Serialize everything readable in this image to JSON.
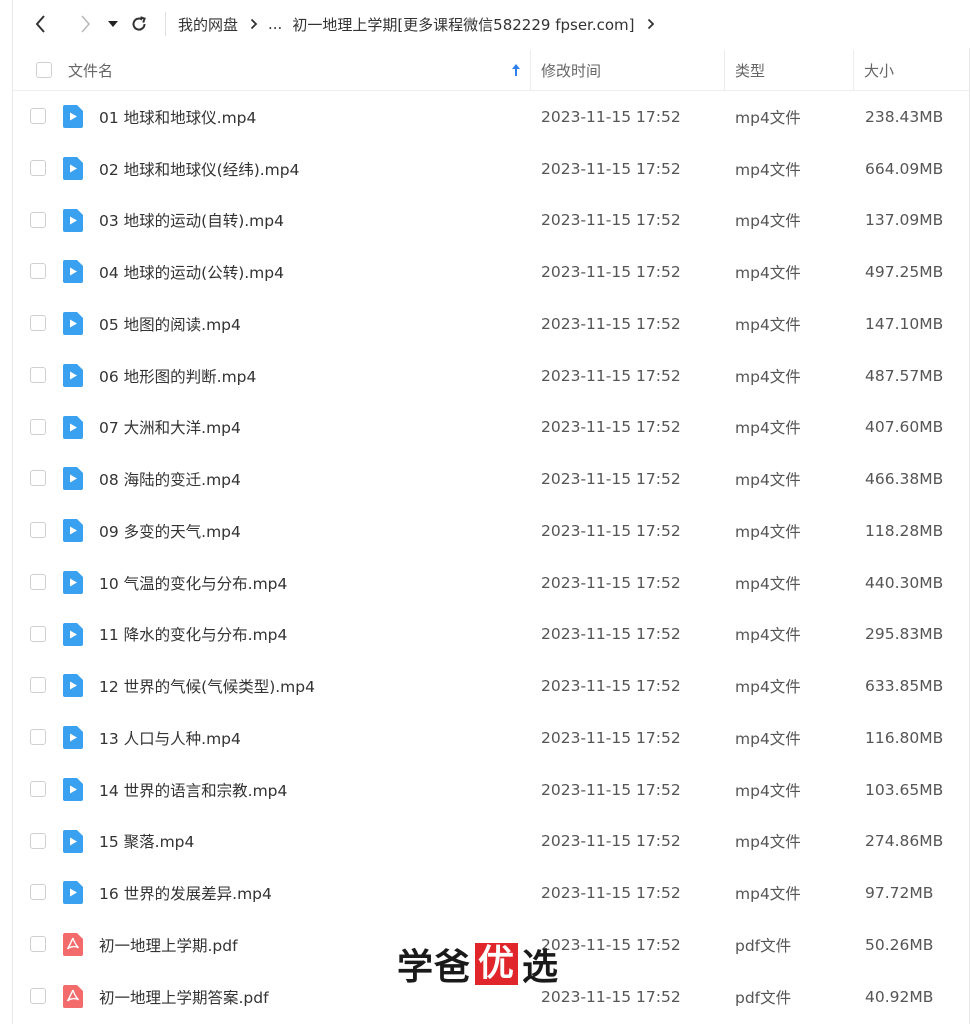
{
  "nav": {
    "back_icon": "chevron-left-icon",
    "forward_icon": "chevron-right-icon",
    "dropdown_icon": "caret-down-icon",
    "refresh_icon": "refresh-icon"
  },
  "breadcrumb": {
    "root": "我的网盘",
    "ellipsis": "...",
    "current": "初一地理上学期[更多课程微信582229 fpser.com]"
  },
  "table": {
    "headers": {
      "name": "文件名",
      "mtime": "修改时间",
      "type": "类型",
      "size": "大小"
    },
    "sort": {
      "column": "name",
      "direction": "ascending",
      "icon": "arrow-up-icon",
      "color": "#2f80ed"
    },
    "rows": [
      {
        "name": "01 地球和地球仪.mp4",
        "mtime": "2023-11-15 17:52",
        "type": "mp4文件",
        "size": "238.43MB",
        "icon": "video-file-icon"
      },
      {
        "name": "02 地球和地球仪(经纬).mp4",
        "mtime": "2023-11-15 17:52",
        "type": "mp4文件",
        "size": "664.09MB",
        "icon": "video-file-icon"
      },
      {
        "name": "03 地球的运动(自转).mp4",
        "mtime": "2023-11-15 17:52",
        "type": "mp4文件",
        "size": "137.09MB",
        "icon": "video-file-icon"
      },
      {
        "name": "04 地球的运动(公转).mp4",
        "mtime": "2023-11-15 17:52",
        "type": "mp4文件",
        "size": "497.25MB",
        "icon": "video-file-icon"
      },
      {
        "name": "05 地图的阅读.mp4",
        "mtime": "2023-11-15 17:52",
        "type": "mp4文件",
        "size": "147.10MB",
        "icon": "video-file-icon"
      },
      {
        "name": "06 地形图的判断.mp4",
        "mtime": "2023-11-15 17:52",
        "type": "mp4文件",
        "size": "487.57MB",
        "icon": "video-file-icon"
      },
      {
        "name": "07 大洲和大洋.mp4",
        "mtime": "2023-11-15 17:52",
        "type": "mp4文件",
        "size": "407.60MB",
        "icon": "video-file-icon"
      },
      {
        "name": "08 海陆的变迁.mp4",
        "mtime": "2023-11-15 17:52",
        "type": "mp4文件",
        "size": "466.38MB",
        "icon": "video-file-icon"
      },
      {
        "name": "09 多变的天气.mp4",
        "mtime": "2023-11-15 17:52",
        "type": "mp4文件",
        "size": "118.28MB",
        "icon": "video-file-icon"
      },
      {
        "name": "10 气温的变化与分布.mp4",
        "mtime": "2023-11-15 17:52",
        "type": "mp4文件",
        "size": "440.30MB",
        "icon": "video-file-icon"
      },
      {
        "name": "11 降水的变化与分布.mp4",
        "mtime": "2023-11-15 17:52",
        "type": "mp4文件",
        "size": "295.83MB",
        "icon": "video-file-icon"
      },
      {
        "name": "12 世界的气候(气候类型).mp4",
        "mtime": "2023-11-15 17:52",
        "type": "mp4文件",
        "size": "633.85MB",
        "icon": "video-file-icon"
      },
      {
        "name": "13 人口与人种.mp4",
        "mtime": "2023-11-15 17:52",
        "type": "mp4文件",
        "size": "116.80MB",
        "icon": "video-file-icon"
      },
      {
        "name": "14 世界的语言和宗教.mp4",
        "mtime": "2023-11-15 17:52",
        "type": "mp4文件",
        "size": "103.65MB",
        "icon": "video-file-icon"
      },
      {
        "name": "15 聚落.mp4",
        "mtime": "2023-11-15 17:52",
        "type": "mp4文件",
        "size": "274.86MB",
        "icon": "video-file-icon"
      },
      {
        "name": "16 世界的发展差异.mp4",
        "mtime": "2023-11-15 17:52",
        "type": "mp4文件",
        "size": "97.72MB",
        "icon": "video-file-icon"
      },
      {
        "name": "初一地理上学期.pdf",
        "mtime": "2023-11-15 17:52",
        "type": "pdf文件",
        "size": "50.26MB",
        "icon": "pdf-file-icon"
      },
      {
        "name": "初一地理上学期答案.pdf",
        "mtime": "2023-11-15 17:52",
        "type": "pdf文件",
        "size": "40.92MB",
        "icon": "pdf-file-icon"
      }
    ]
  },
  "colors": {
    "video_icon": "#3aa0f0",
    "pdf_icon": "#f46b6b",
    "watermark_red": "#e0262b"
  },
  "watermark": {
    "part1": "学爸",
    "part2": "优",
    "part3": "选"
  }
}
